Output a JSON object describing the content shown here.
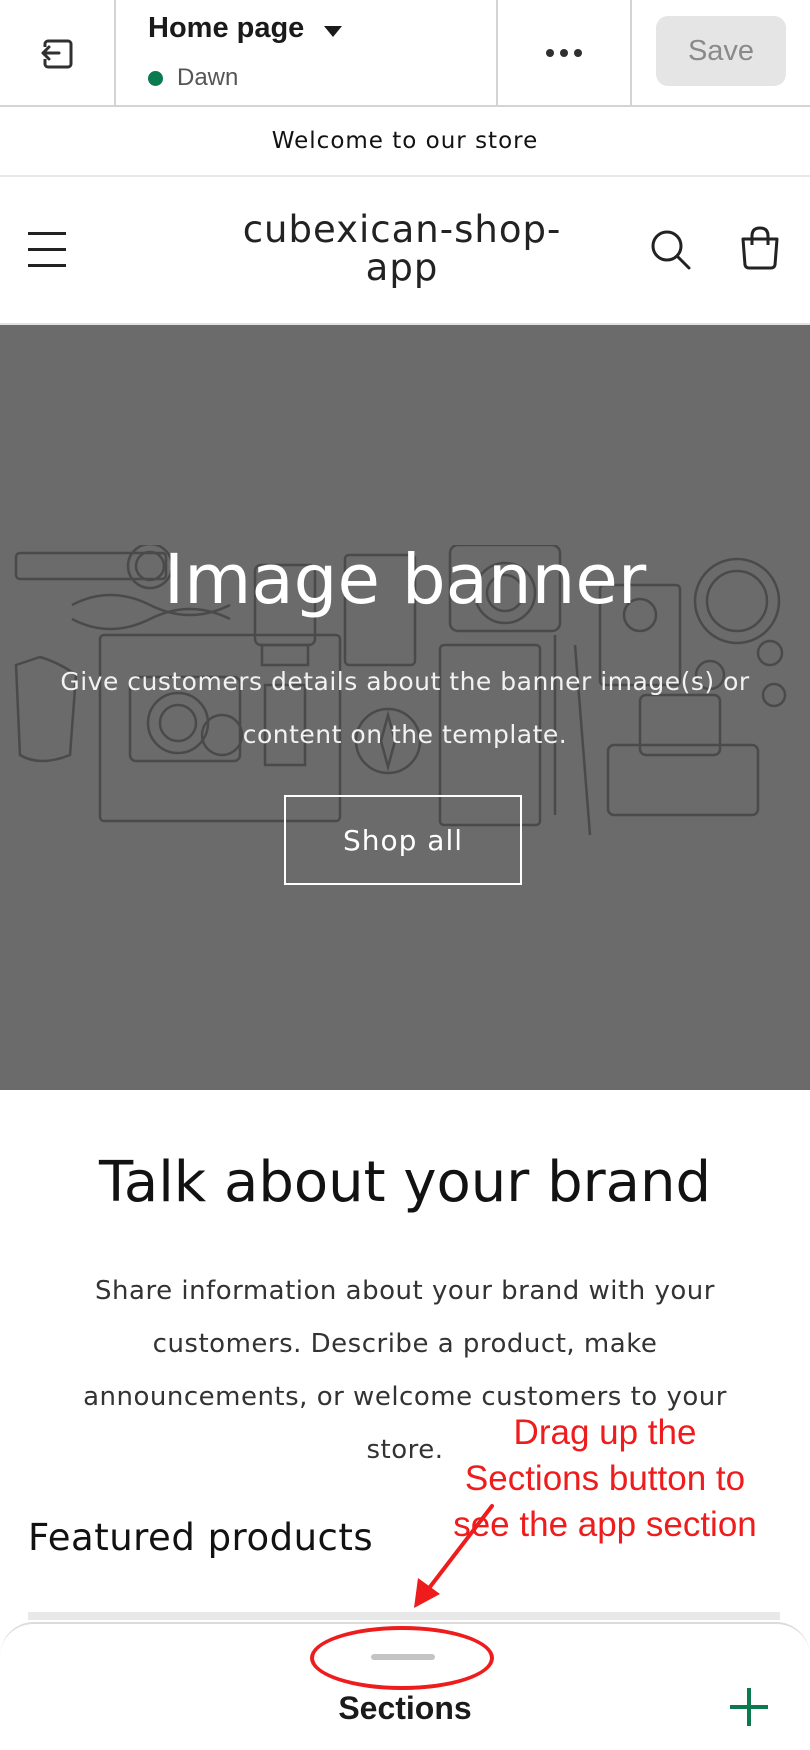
{
  "editor": {
    "page_name": "Home page",
    "theme_name": "Dawn",
    "save_label": "Save",
    "icons": [
      "exit-icon",
      "chevron-down-icon",
      "more-icon"
    ]
  },
  "store": {
    "announcement": "Welcome to our store",
    "name": "cubexican-shop-app",
    "icons": [
      "menu-icon",
      "search-icon",
      "cart-icon"
    ]
  },
  "banner": {
    "title": "Image banner",
    "text": "Give customers details about the banner image(s) or content on the template.",
    "button_label": "Shop all"
  },
  "brand": {
    "title": "Talk about your brand",
    "text": "Share information about your brand with your customers. Describe a product, make announcements, or welcome customers to your store."
  },
  "featured": {
    "title": "Featured products"
  },
  "annotation": {
    "text": "Drag up the Sections button to see the app section"
  },
  "sheet": {
    "title": "Sections",
    "icons": [
      "plus-icon"
    ]
  },
  "colors": {
    "theme_dot": "#0c7a4f",
    "banner_bg": "#6b6b6b",
    "annotation": "#ee1c1c"
  }
}
